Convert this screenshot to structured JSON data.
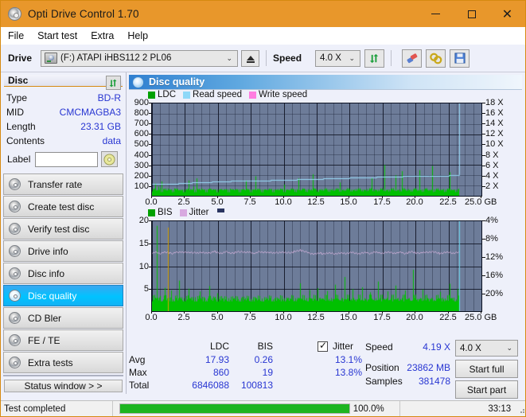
{
  "window": {
    "title": "Opti Drive Control 1.70",
    "icon": "disc-icon",
    "minimize": "─",
    "maximize": "□",
    "close": "✕"
  },
  "menu": {
    "items": [
      "File",
      "Start test",
      "Extra",
      "Help"
    ]
  },
  "toolbar": {
    "drive_label": "Drive",
    "drive_value": "(F:)  ATAPI iHBS112  2 PL06",
    "eject_icon": "eject-icon",
    "speed_label": "Speed",
    "speed_value": "4.0 X",
    "refresh_icon": "refresh-icon",
    "erase_icon": "eraser-icon",
    "bitsetting_icon": "bitsetting-icon",
    "save_icon": "save-icon",
    "caret": "⌄"
  },
  "disc_panel": {
    "title": "Disc",
    "refresh_icon": "refresh-icon",
    "rows": [
      {
        "key": "Type",
        "value": "BD-R"
      },
      {
        "key": "MID",
        "value": "CMCMAGBA3"
      },
      {
        "key": "Length",
        "value": "23.31 GB"
      },
      {
        "key": "Contents",
        "value": "data"
      }
    ],
    "label_key": "Label",
    "label_value": "",
    "label_placeholder": "",
    "label_button_icon": "disc-label-icon"
  },
  "sidebar": {
    "items": [
      {
        "label": "Transfer rate",
        "icon": "transfer-rate-icon",
        "active": false
      },
      {
        "label": "Create test disc",
        "icon": "create-test-disc-icon",
        "active": false
      },
      {
        "label": "Verify test disc",
        "icon": "verify-test-disc-icon",
        "active": false
      },
      {
        "label": "Drive info",
        "icon": "drive-info-icon",
        "active": false
      },
      {
        "label": "Disc info",
        "icon": "disc-info-icon",
        "active": false
      },
      {
        "label": "Disc quality",
        "icon": "disc-quality-icon",
        "active": true
      },
      {
        "label": "CD Bler",
        "icon": "cd-bler-icon",
        "active": false
      },
      {
        "label": "FE / TE",
        "icon": "fe-te-icon",
        "active": false
      },
      {
        "label": "Extra tests",
        "icon": "extra-tests-icon",
        "active": false
      }
    ],
    "status_window": "Status window > >"
  },
  "panel": {
    "title": "Disc quality",
    "icon": "disc-quality-icon"
  },
  "chart_data": [
    {
      "type": "line",
      "id": "ldc-chart",
      "title": "",
      "xlabel": "GB",
      "ylabel": "",
      "legend": [
        {
          "label": "LDC",
          "color": "#00a000"
        },
        {
          "label": "Read speed",
          "color": "#8ed8f8"
        },
        {
          "label": "Write speed",
          "color": "#ff7de0"
        }
      ],
      "legend_position": "top-left",
      "grid": true,
      "x": [
        0.0,
        2.5,
        5.0,
        7.5,
        10.0,
        12.5,
        15.0,
        17.5,
        20.0,
        22.5,
        25.0
      ],
      "xticklabels": [
        "0.0",
        "2.5",
        "5.0",
        "7.5",
        "10.0",
        "12.5",
        "15.0",
        "17.5",
        "20.0",
        "22.5",
        "25.0 GB"
      ],
      "xlim": [
        0.0,
        25.0
      ],
      "ylim": [
        0,
        900
      ],
      "yticklabels": [
        "900",
        "800",
        "700",
        "600",
        "500",
        "400",
        "300",
        "200",
        "100"
      ],
      "y2lim": [
        0,
        18
      ],
      "y2ticklabels": [
        "18 X",
        "16 X",
        "14 X",
        "12 X",
        "10 X",
        "8 X",
        "6 X",
        "4 X",
        "2 X"
      ],
      "series": [
        {
          "name": "LDC",
          "color": "#00c000",
          "axis": "left",
          "note": "dense green error spikes, baseline ~20-60, peaks up to 860",
          "values": [
            42,
            60,
            120,
            860,
            55,
            90,
            75,
            180,
            140,
            65,
            55,
            48,
            52,
            70,
            60,
            58,
            62,
            55,
            66,
            72,
            58,
            64,
            60,
            55,
            52,
            58,
            54,
            60,
            56,
            58,
            62,
            150,
            64,
            58,
            70,
            90,
            58,
            62,
            170,
            60,
            58,
            66,
            74,
            58,
            60,
            64,
            58,
            62,
            70,
            58,
            66,
            60,
            58,
            64,
            58,
            60,
            70,
            58,
            62,
            58,
            66,
            60,
            58,
            62,
            58,
            60,
            70,
            58,
            64,
            62,
            58,
            60,
            66,
            58,
            62,
            58,
            60,
            64,
            58,
            62,
            150,
            60,
            58,
            66,
            58,
            62,
            58,
            60,
            190,
            64,
            58,
            62,
            58,
            60,
            66,
            58,
            62,
            58,
            130,
            60,
            58,
            64,
            70,
            58,
            62,
            58,
            60,
            66,
            58,
            62,
            58,
            60,
            110,
            64,
            58,
            62,
            58,
            60,
            66,
            58,
            62,
            58,
            60,
            64,
            170,
            62,
            58,
            60,
            66,
            58,
            62,
            58,
            60,
            64,
            58,
            62,
            58,
            210,
            66,
            58,
            62,
            58,
            60,
            64,
            58,
            62,
            58,
            60,
            230,
            58,
            62,
            58,
            60,
            66,
            58,
            62,
            58,
            60,
            64,
            58,
            130,
            58,
            60,
            66,
            58,
            62,
            58,
            60,
            64,
            58,
            62,
            58,
            60,
            66,
            58,
            62,
            58,
            60,
            230,
            58,
            62,
            58,
            60,
            66,
            58,
            62,
            58,
            170,
            64,
            58,
            62,
            58,
            60,
            66,
            58,
            62,
            58,
            60,
            300,
            58,
            62,
            58,
            60,
            66,
            58,
            62,
            58,
            200,
            64,
            58,
            62,
            58,
            60,
            240,
            58,
            62,
            58,
            60,
            66,
            58,
            62,
            58,
            60,
            64,
            58,
            62,
            58,
            60,
            250,
            58,
            62,
            58,
            60,
            66,
            58,
            62,
            58,
            60,
            290,
            58,
            62,
            58,
            60,
            64,
            58,
            62,
            58,
            60,
            66,
            58,
            62,
            58,
            60,
            230,
            58,
            62,
            58,
            60,
            64,
            58,
            62,
            58,
            60
          ]
        },
        {
          "name": "Read speed",
          "color": "#9bdcfa",
          "axis": "right",
          "note": "CAV staircase rising from ~2.4X to ~4.2X then vertical spike at end",
          "x": [
            0.0,
            1.0,
            2.0,
            3.0,
            4.5,
            6.0,
            7.5,
            9.0,
            11.0,
            13.0,
            15.0,
            17.0,
            19.0,
            21.0,
            22.5,
            23.3,
            23.3
          ],
          "values": [
            2.3,
            2.4,
            2.5,
            2.6,
            2.75,
            2.9,
            3.0,
            3.1,
            3.25,
            3.4,
            3.55,
            3.7,
            3.85,
            3.95,
            4.1,
            4.2,
            18.0
          ]
        }
      ]
    },
    {
      "type": "line",
      "id": "bis-chart",
      "title": "",
      "xlabel": "GB",
      "ylabel": "",
      "legend": [
        {
          "label": "BIS",
          "color": "#00a000"
        },
        {
          "label": "Jitter",
          "color": "#e2b3e8"
        }
      ],
      "legend_position": "top-left",
      "grid": true,
      "x": [
        0.0,
        2.5,
        5.0,
        7.5,
        10.0,
        12.5,
        15.0,
        17.5,
        20.0,
        22.5,
        25.0
      ],
      "xticklabels": [
        "0.0",
        "2.5",
        "5.0",
        "7.5",
        "10.0",
        "12.5",
        "15.0",
        "17.5",
        "20.0",
        "22.5",
        "25.0 GB"
      ],
      "xlim": [
        0.0,
        25.0
      ],
      "ylim": [
        0,
        20
      ],
      "yticklabels": [
        "20",
        "15",
        "10",
        "5"
      ],
      "y2lim": [
        0,
        20
      ],
      "y2ticklabels": [
        "20%",
        "16%",
        "12%",
        "8%",
        "4%"
      ],
      "series": [
        {
          "name": "BIS",
          "color": "#00c000",
          "axis": "left",
          "note": "dense green baseline ~2-3 with spikes to 19",
          "values": [
            2.2,
            2.5,
            3.0,
            19.0,
            2.4,
            3.4,
            2.8,
            2.2,
            2.6,
            5.2,
            2.4,
            2.8,
            2.2,
            3.0,
            4.6,
            2.6,
            2.2,
            2.9,
            2.4,
            6.8,
            2.2,
            2.7,
            2.4,
            2.9,
            2.3,
            2.6,
            5.0,
            2.2,
            2.8,
            2.4,
            2.6,
            3.1,
            2.2,
            2.7,
            2.4,
            4.4,
            2.6,
            2.2,
            2.9,
            2.4,
            2.8,
            2.2,
            5.6,
            2.5,
            2.3,
            2.9,
            2.6,
            2.2,
            4.0,
            2.7,
            2.4,
            2.8,
            2.2,
            2.6,
            6.4,
            2.3,
            2.9,
            2.5,
            2.2,
            2.8,
            2.6,
            4.2,
            2.3,
            2.7,
            2.4,
            2.9,
            2.2,
            2.6,
            5.8,
            2.4,
            2.8,
            2.3,
            2.7,
            2.5,
            2.2,
            4.8,
            2.9,
            2.4,
            2.6,
            2.3,
            2.8,
            2.2,
            6.0,
            2.5,
            2.7,
            2.4,
            2.9,
            2.2,
            2.6,
            4.3,
            2.8,
            2.3,
            2.7,
            2.5,
            2.2,
            5.4,
            2.6,
            2.9,
            2.4,
            2.8,
            2.3,
            2.7,
            4.1,
            2.5,
            2.2,
            2.9,
            2.6,
            2.8,
            6.2,
            2.3,
            2.7,
            2.4,
            2.5,
            2.9,
            2.2,
            4.7,
            2.6,
            2.8,
            2.3,
            2.7,
            2.4,
            5.1,
            2.9,
            2.2,
            2.6,
            2.8,
            2.5,
            2.3,
            4.5,
            2.7,
            2.9,
            2.4,
            2.2,
            2.6,
            5.9,
            2.8,
            2.3,
            2.7,
            2.5,
            2.9,
            2.2,
            7.6,
            2.6,
            2.4,
            2.8,
            2.3,
            2.7,
            4.9,
            2.5,
            2.2,
            2.9,
            2.6,
            2.8,
            2.4,
            5.3,
            2.3,
            2.7,
            2.9,
            2.2,
            2.6,
            4.2,
            2.8,
            2.5,
            2.3,
            2.7,
            2.4,
            6.6,
            2.9,
            2.2,
            2.6,
            2.8,
            2.3,
            2.7,
            4.4,
            2.5,
            2.9,
            2.2,
            2.6,
            2.4,
            5.7,
            2.8,
            2.3,
            2.7,
            2.9,
            2.5,
            2.2,
            4.6,
            2.6,
            2.8,
            2.4,
            2.3,
            2.7,
            9.2,
            2.9,
            2.5,
            2.2,
            2.6,
            2.8,
            2.3,
            4.8,
            2.7,
            2.4,
            2.9,
            2.2,
            2.6,
            5.5,
            2.8,
            2.5,
            2.3,
            2.7,
            2.9,
            4.3,
            2.4,
            2.2,
            2.6,
            2.8,
            2.5,
            2.3,
            6.1,
            2.7,
            2.9,
            2.4,
            2.2,
            2.6,
            4.9,
            2.8,
            2.3
          ]
        },
        {
          "name": "Jitter",
          "color": "#e6bce9",
          "axis": "right",
          "note": "roughly flat around 13.0-13.8% across the disc",
          "values": [
            13.0,
            13.1,
            13.0,
            13.2,
            13.1,
            13.0,
            13.2,
            13.1,
            13.3,
            13.1,
            13.0,
            13.2,
            13.1,
            13.0,
            13.2,
            13.1,
            13.3,
            13.1,
            13.0,
            13.2,
            13.1,
            13.0,
            13.2,
            13.4,
            13.2,
            13.1,
            13.0,
            13.2,
            13.1,
            13.3,
            13.1,
            13.0,
            13.2,
            13.1,
            13.0,
            13.2,
            13.1,
            13.3,
            13.8,
            13.4,
            13.1,
            12.9,
            12.8,
            12.9,
            13.0,
            12.9,
            13.0,
            12.9,
            13.0,
            12.9,
            13.0,
            13.1,
            13.0,
            12.9,
            13.0,
            13.1,
            13.0,
            13.2,
            13.1,
            13.0,
            13.1,
            13.2,
            13.1,
            13.0,
            13.1,
            13.0,
            13.1,
            13.2,
            13.1,
            13.0,
            13.1,
            13.3,
            13.2,
            13.1,
            13.0,
            13.1,
            13.2,
            13.1,
            13.0,
            13.1
          ]
        }
      ]
    }
  ],
  "stats": {
    "columns": [
      "",
      "LDC",
      "BIS"
    ],
    "jitter_label": "Jitter",
    "jitter_checked": true,
    "rows": [
      {
        "name": "Avg",
        "ldc": "17.93",
        "bis": "0.26",
        "jitter": "13.1%"
      },
      {
        "name": "Max",
        "ldc": "860",
        "bis": "19",
        "jitter": "13.8%"
      },
      {
        "name": "Total",
        "ldc": "6846088",
        "bis": "100813",
        "jitter": ""
      }
    ]
  },
  "readout": {
    "speed_label": "Speed",
    "speed_value": "4.19 X",
    "position_label": "Position",
    "position_value": "23862 MB",
    "samples_label": "Samples",
    "samples_value": "381478",
    "speed_select": "4.0 X",
    "start_full": "Start full",
    "start_part": "Start part"
  },
  "statusbar": {
    "message": "Test completed",
    "progress_text": "100.0%",
    "progress_value": 100,
    "elapsed": "33:13"
  },
  "colors": {
    "accent": "#e8972b",
    "link": "#2836d2",
    "ldc_green": "#00c000",
    "read_speed": "#9bdcfa",
    "write_speed": "#ff7de0",
    "jitter": "#e6bce9",
    "progress": "#1db520",
    "plot_bg": "#6d7c99",
    "selected": "#00c3ff"
  }
}
